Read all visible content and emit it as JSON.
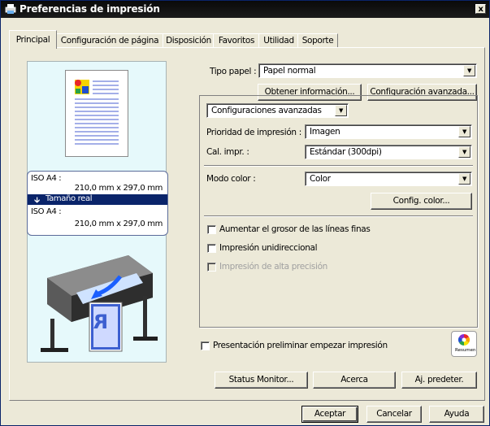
{
  "window": {
    "title": "Preferencias de impresión",
    "close_label": "x"
  },
  "tabs": [
    {
      "label": "Principal"
    },
    {
      "label": "Configuración de página"
    },
    {
      "label": "Disposición"
    },
    {
      "label": "Favoritos"
    },
    {
      "label": "Utilidad"
    },
    {
      "label": "Soporte"
    }
  ],
  "preview": {
    "input_paper_name": "ISO A4 :",
    "input_paper_size": "210,0 mm x 297,0 mm",
    "scaling_label": "Tamaño real",
    "output_paper_name": "ISO A4 :",
    "output_paper_size": "210,0 mm x 297,0 mm",
    "printout_letter": "R"
  },
  "media": {
    "label": "Tipo papel :",
    "value": "Papel normal",
    "get_info_button": "Obtener información...",
    "advanced_settings_button": "Configuración avanzada..."
  },
  "advanced": {
    "mode_select": "Configuraciones avanzadas",
    "priority_label": "Prioridad de impresión :",
    "priority_value": "Imagen",
    "quality_label": "Cal. impr. :",
    "quality_value": "Estándar (300dpi)",
    "color_mode_label": "Modo color :",
    "color_mode_value": "Color",
    "color_settings_button": "Config. color...",
    "options": [
      {
        "label": "Aumentar el grosor de las líneas finas",
        "checked": false,
        "enabled": true
      },
      {
        "label": "Impresión unidireccional",
        "checked": false,
        "enabled": true
      },
      {
        "label": "Impresión de alta precisión",
        "checked": false,
        "enabled": false
      }
    ]
  },
  "preview_option": {
    "label": "Presentación preliminar empezar impresión",
    "checked": false
  },
  "summary_badge": {
    "label": "Resumen"
  },
  "actions": {
    "status_monitor": "Status Monitor...",
    "about": "Acerca",
    "defaults": "Aj. predeter."
  },
  "footer": {
    "ok": "Aceptar",
    "cancel": "Cancelar",
    "help": "Ayuda"
  }
}
